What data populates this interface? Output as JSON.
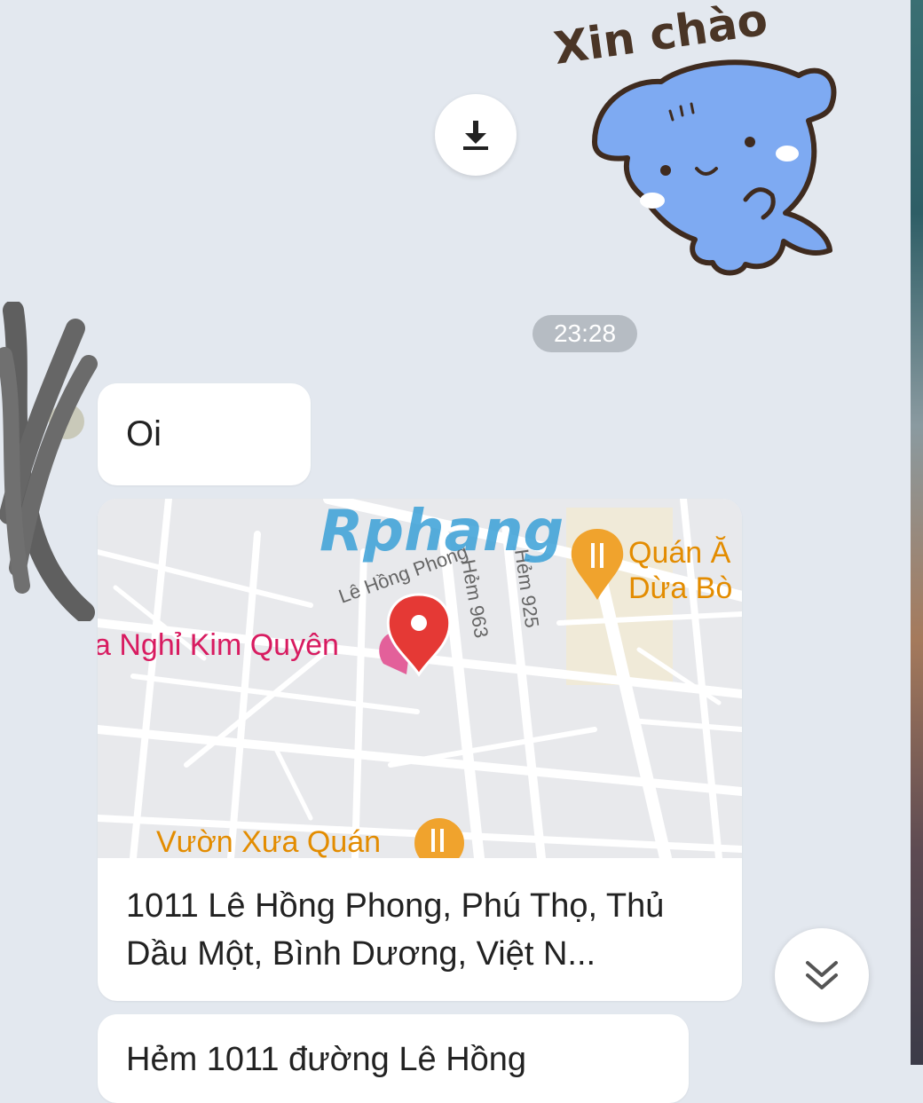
{
  "sticker": {
    "caption": "Xin chào"
  },
  "timestamp": "23:28",
  "messages": {
    "oi": "Oi",
    "location_address": "1011 Lê Hồng Phong, Phú Thọ, Thủ Dầu Một, Bình Dương, Việt N...",
    "next_message_partial": "Hẻm 1011 đường Lê Hồng"
  },
  "map": {
    "labels": {
      "street_main": "Lê Hồng Phong",
      "alley_963": "Hẻm 963",
      "alley_925": "Hẻm 925",
      "poi_lodging": "a Nghỉ Kim Quyên",
      "poi_restaurant_top_line1": "Quán Ă",
      "poi_restaurant_top_line2": "Dừa Bò",
      "poi_restaurant_bottom": "Vườn Xưa Quán"
    }
  },
  "watermark": "Rphang",
  "icons": {
    "download": "download-icon",
    "scroll_down": "double-chevron-down-icon",
    "pin": "map-pin-icon",
    "restaurant": "restaurant-icon"
  },
  "colors": {
    "background": "#e3e8ef",
    "bubble": "#ffffff",
    "pin_red": "#e53935",
    "poi_orange": "#e38c00",
    "poi_pink": "#d81b60",
    "sticker_blue": "#7eaaf2"
  }
}
